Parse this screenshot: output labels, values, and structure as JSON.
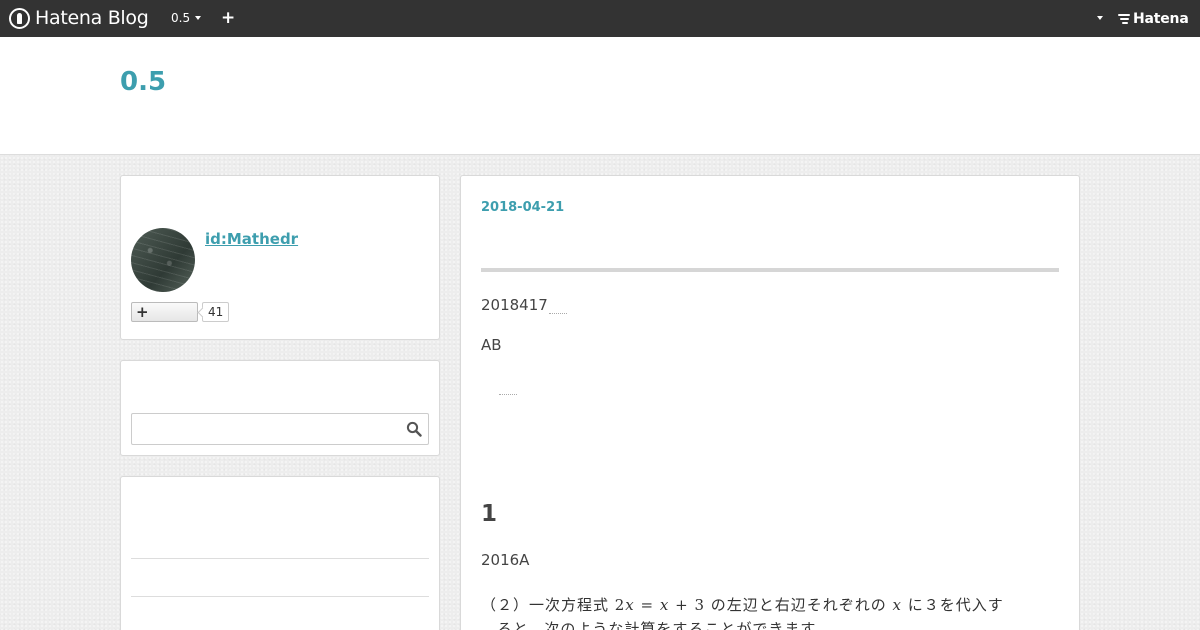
{
  "globalbar": {
    "logo_text": "Hatena Blog",
    "blog_menu_label": "0.5",
    "add_label": "+",
    "hatena_label": "Hatena"
  },
  "header": {
    "blog_title": "0.5"
  },
  "sidebar": {
    "profile": {
      "id_label": "id:Mathedr",
      "follow_label": "+",
      "follower_count": "41"
    },
    "search": {
      "placeholder": ""
    }
  },
  "entry": {
    "date": "2018-04-21",
    "paragraph_1": "2018417",
    "paragraph_2": "AB",
    "heading": "1",
    "paragraph_3": "2016A",
    "math_line_1": "（２）一次方程式 2𝑥 = 𝑥 + 3 の左辺と右辺それぞれの 𝑥 に３を代入す",
    "math_line_2": "　ると，次のような計算をすることができます。"
  },
  "colors": {
    "accent": "#3d9eae",
    "topbar": "#333333"
  },
  "icons": {
    "logo": "hatena-blog-logo-icon",
    "search": "search-icon",
    "hatena": "hatena-logo-icon"
  }
}
